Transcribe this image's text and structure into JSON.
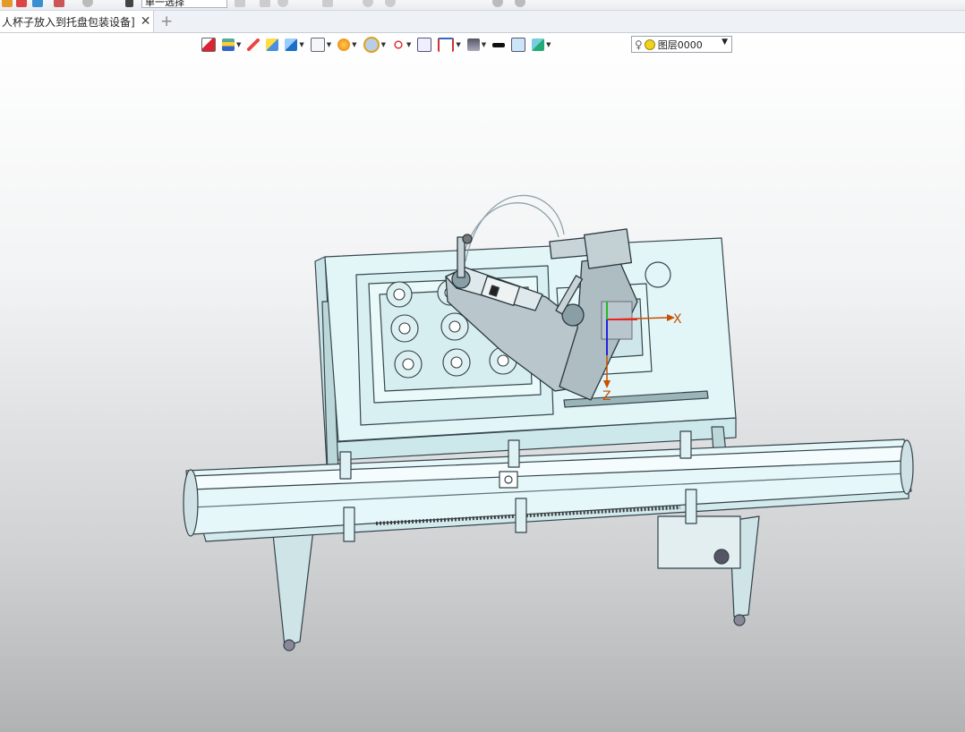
{
  "toolbar": {
    "select_value": "单一选择"
  },
  "tabs": [
    {
      "label": "人杯子放入到托盘包装设备]",
      "close": "✕"
    }
  ],
  "new_tab": "+",
  "view_toolbar": {
    "layer_name": "图层0000",
    "icons": [
      "exit-sketch-icon",
      "layer-stack-icon",
      "pencil-icon",
      "solid-cube-icon",
      "blue-cube-icon",
      "wire-cube-icon",
      "render-style-icon",
      "view-fit-icon",
      "axis-icon",
      "frame-icon",
      "dimension-icon",
      "background-icon",
      "line-color-icon",
      "fill-color-icon",
      "layer-icon"
    ]
  },
  "triad": {
    "x_label": "X",
    "z_label": "Z"
  },
  "colors": {
    "model_fill": "#dff4f6",
    "model_stroke": "#3b4a52",
    "axis_x": "#c85000",
    "axis_z": "#c85000"
  }
}
